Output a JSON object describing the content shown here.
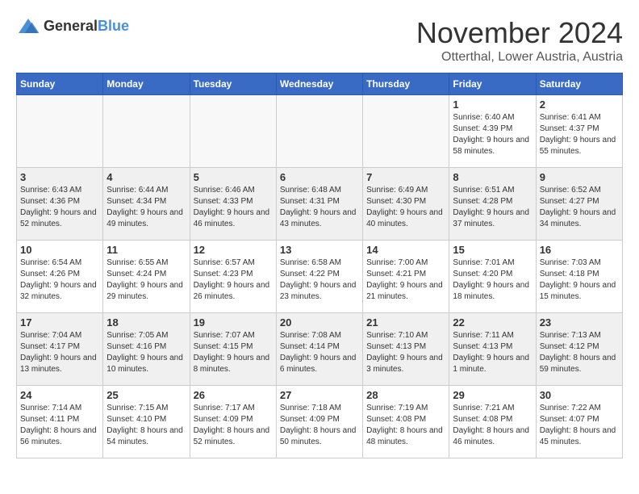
{
  "logo": {
    "text_general": "General",
    "text_blue": "Blue"
  },
  "header": {
    "month_year": "November 2024",
    "location": "Otterthal, Lower Austria, Austria"
  },
  "weekdays": [
    "Sunday",
    "Monday",
    "Tuesday",
    "Wednesday",
    "Thursday",
    "Friday",
    "Saturday"
  ],
  "weeks": [
    {
      "days": [
        {
          "date": "",
          "empty": true
        },
        {
          "date": "",
          "empty": true
        },
        {
          "date": "",
          "empty": true
        },
        {
          "date": "",
          "empty": true
        },
        {
          "date": "",
          "empty": true
        },
        {
          "date": "1",
          "sunrise": "6:40 AM",
          "sunset": "4:39 PM",
          "daylight": "9 hours and 58 minutes."
        },
        {
          "date": "2",
          "sunrise": "6:41 AM",
          "sunset": "4:37 PM",
          "daylight": "9 hours and 55 minutes."
        }
      ]
    },
    {
      "days": [
        {
          "date": "3",
          "sunrise": "6:43 AM",
          "sunset": "4:36 PM",
          "daylight": "9 hours and 52 minutes."
        },
        {
          "date": "4",
          "sunrise": "6:44 AM",
          "sunset": "4:34 PM",
          "daylight": "9 hours and 49 minutes."
        },
        {
          "date": "5",
          "sunrise": "6:46 AM",
          "sunset": "4:33 PM",
          "daylight": "9 hours and 46 minutes."
        },
        {
          "date": "6",
          "sunrise": "6:48 AM",
          "sunset": "4:31 PM",
          "daylight": "9 hours and 43 minutes."
        },
        {
          "date": "7",
          "sunrise": "6:49 AM",
          "sunset": "4:30 PM",
          "daylight": "9 hours and 40 minutes."
        },
        {
          "date": "8",
          "sunrise": "6:51 AM",
          "sunset": "4:28 PM",
          "daylight": "9 hours and 37 minutes."
        },
        {
          "date": "9",
          "sunrise": "6:52 AM",
          "sunset": "4:27 PM",
          "daylight": "9 hours and 34 minutes."
        }
      ]
    },
    {
      "days": [
        {
          "date": "10",
          "sunrise": "6:54 AM",
          "sunset": "4:26 PM",
          "daylight": "9 hours and 32 minutes."
        },
        {
          "date": "11",
          "sunrise": "6:55 AM",
          "sunset": "4:24 PM",
          "daylight": "9 hours and 29 minutes."
        },
        {
          "date": "12",
          "sunrise": "6:57 AM",
          "sunset": "4:23 PM",
          "daylight": "9 hours and 26 minutes."
        },
        {
          "date": "13",
          "sunrise": "6:58 AM",
          "sunset": "4:22 PM",
          "daylight": "9 hours and 23 minutes."
        },
        {
          "date": "14",
          "sunrise": "7:00 AM",
          "sunset": "4:21 PM",
          "daylight": "9 hours and 21 minutes."
        },
        {
          "date": "15",
          "sunrise": "7:01 AM",
          "sunset": "4:20 PM",
          "daylight": "9 hours and 18 minutes."
        },
        {
          "date": "16",
          "sunrise": "7:03 AM",
          "sunset": "4:18 PM",
          "daylight": "9 hours and 15 minutes."
        }
      ]
    },
    {
      "days": [
        {
          "date": "17",
          "sunrise": "7:04 AM",
          "sunset": "4:17 PM",
          "daylight": "9 hours and 13 minutes."
        },
        {
          "date": "18",
          "sunrise": "7:05 AM",
          "sunset": "4:16 PM",
          "daylight": "9 hours and 10 minutes."
        },
        {
          "date": "19",
          "sunrise": "7:07 AM",
          "sunset": "4:15 PM",
          "daylight": "9 hours and 8 minutes."
        },
        {
          "date": "20",
          "sunrise": "7:08 AM",
          "sunset": "4:14 PM",
          "daylight": "9 hours and 6 minutes."
        },
        {
          "date": "21",
          "sunrise": "7:10 AM",
          "sunset": "4:13 PM",
          "daylight": "9 hours and 3 minutes."
        },
        {
          "date": "22",
          "sunrise": "7:11 AM",
          "sunset": "4:13 PM",
          "daylight": "9 hours and 1 minute."
        },
        {
          "date": "23",
          "sunrise": "7:13 AM",
          "sunset": "4:12 PM",
          "daylight": "8 hours and 59 minutes."
        }
      ]
    },
    {
      "days": [
        {
          "date": "24",
          "sunrise": "7:14 AM",
          "sunset": "4:11 PM",
          "daylight": "8 hours and 56 minutes."
        },
        {
          "date": "25",
          "sunrise": "7:15 AM",
          "sunset": "4:10 PM",
          "daylight": "8 hours and 54 minutes."
        },
        {
          "date": "26",
          "sunrise": "7:17 AM",
          "sunset": "4:09 PM",
          "daylight": "8 hours and 52 minutes."
        },
        {
          "date": "27",
          "sunrise": "7:18 AM",
          "sunset": "4:09 PM",
          "daylight": "8 hours and 50 minutes."
        },
        {
          "date": "28",
          "sunrise": "7:19 AM",
          "sunset": "4:08 PM",
          "daylight": "8 hours and 48 minutes."
        },
        {
          "date": "29",
          "sunrise": "7:21 AM",
          "sunset": "4:08 PM",
          "daylight": "8 hours and 46 minutes."
        },
        {
          "date": "30",
          "sunrise": "7:22 AM",
          "sunset": "4:07 PM",
          "daylight": "8 hours and 45 minutes."
        }
      ]
    }
  ]
}
